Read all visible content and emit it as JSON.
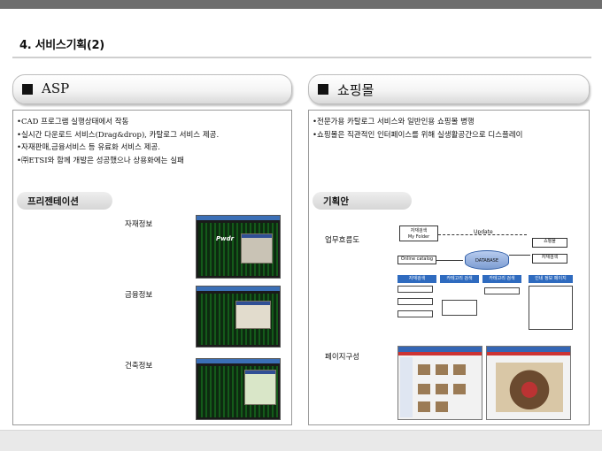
{
  "page": {
    "title": "4. 서비스기획(2)"
  },
  "left": {
    "header": "ASP",
    "bullets": [
      "•CAD 프로그램 실행상태에서 작동",
      "•실시간 다운로드 서비스(Drag&drop), 카탈로그 서비스 제공.",
      "•자재판매,금융서비스 등 유료화 서비스 제공.",
      "•㈜ETSI와 함께 개발은 성공했으나 상용화에는 실패"
    ],
    "section_label": "프리젠테이션",
    "captions": [
      "자재정보",
      "금융정보",
      "건축정보"
    ],
    "shot1_text": "Pwdr"
  },
  "right": {
    "header": "쇼핑몰",
    "bullets": [
      "•전문가용 카탈로그 서비스와 일반인용 쇼핑몰 병행",
      "•쇼핑몰은 직관적인 인터페이스를 위해 실생활공간으로 디스플레이"
    ],
    "section_label": "기획안",
    "flow_label": "업무흐름도",
    "page_label": "페이지구성",
    "flow": {
      "folder": "자재검색\nMy Folder",
      "update": "Update",
      "catalog": "Online catalog",
      "database": "DATABASE",
      "mall": "쇼핑몰",
      "material": "자재검색",
      "tabs": [
        "자재검색",
        "카테고리 검색",
        "카테고리 검색",
        "인네 정보 페이지"
      ]
    }
  }
}
